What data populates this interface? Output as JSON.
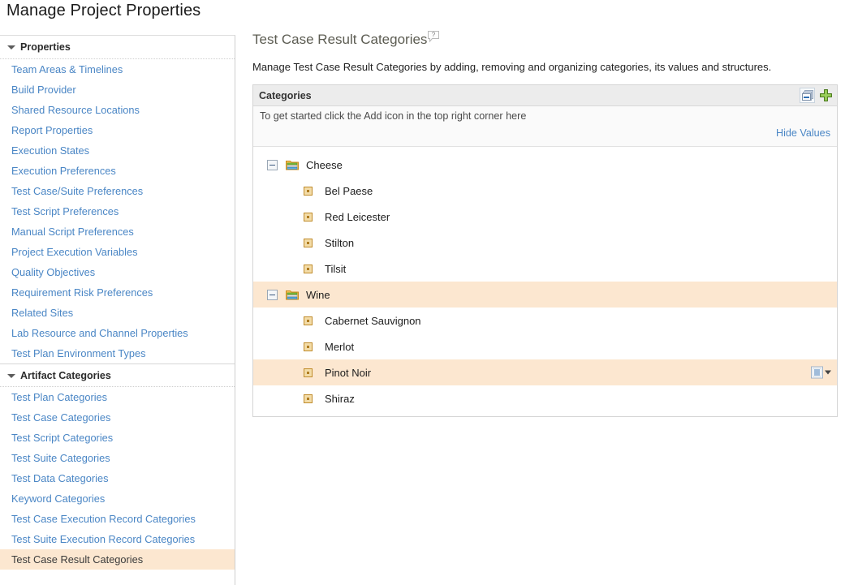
{
  "page": {
    "title": "Manage Project Properties"
  },
  "sidebar": {
    "sections": [
      {
        "title": "Properties",
        "items": [
          {
            "label": "Team Areas & Timelines",
            "selected": false
          },
          {
            "label": "Build Provider",
            "selected": false
          },
          {
            "label": "Shared Resource Locations",
            "selected": false
          },
          {
            "label": "Report Properties",
            "selected": false
          },
          {
            "label": "Execution States",
            "selected": false
          },
          {
            "label": "Execution Preferences",
            "selected": false
          },
          {
            "label": "Test Case/Suite Preferences",
            "selected": false
          },
          {
            "label": "Test Script Preferences",
            "selected": false
          },
          {
            "label": "Manual Script Preferences",
            "selected": false
          },
          {
            "label": "Project Execution Variables",
            "selected": false
          },
          {
            "label": "Quality Objectives",
            "selected": false
          },
          {
            "label": "Requirement Risk Preferences",
            "selected": false
          },
          {
            "label": "Related Sites",
            "selected": false
          },
          {
            "label": "Lab Resource and Channel Properties",
            "selected": false
          },
          {
            "label": "Test Plan Environment Types",
            "selected": false
          }
        ]
      },
      {
        "title": "Artifact Categories",
        "items": [
          {
            "label": "Test Plan Categories",
            "selected": false
          },
          {
            "label": "Test Case Categories",
            "selected": false
          },
          {
            "label": "Test Script Categories",
            "selected": false
          },
          {
            "label": "Test Suite Categories",
            "selected": false
          },
          {
            "label": "Test Data Categories",
            "selected": false
          },
          {
            "label": "Keyword Categories",
            "selected": false
          },
          {
            "label": "Test Case Execution Record Categories",
            "selected": false
          },
          {
            "label": "Test Suite Execution Record Categories",
            "selected": false
          },
          {
            "label": "Test Case Result Categories",
            "selected": true
          }
        ]
      }
    ]
  },
  "main": {
    "heading": "Test Case Result Categories",
    "help_icon": "help-question-icon",
    "description": "Manage Test Case Result Categories by adding, removing and organizing categories, its values and structures.",
    "panel": {
      "header_title": "Categories",
      "tools": [
        {
          "name": "collapse-all-icon",
          "label": "Collapse All"
        },
        {
          "name": "add-icon",
          "label": "Add"
        }
      ],
      "hint": "To get started click the Add icon in the top right corner here",
      "hide_values_label": "Hide Values",
      "tree": [
        {
          "type": "category",
          "label": "Cheese",
          "expanded": true,
          "highlight": false,
          "menu": false,
          "values": [
            {
              "label": "Bel Paese",
              "highlight": false,
              "menu": false
            },
            {
              "label": "Red Leicester",
              "highlight": false,
              "menu": false
            },
            {
              "label": "Stilton",
              "highlight": false,
              "menu": false
            },
            {
              "label": "Tilsit",
              "highlight": false,
              "menu": false
            }
          ]
        },
        {
          "type": "category",
          "label": "Wine",
          "expanded": true,
          "highlight": true,
          "menu": false,
          "values": [
            {
              "label": "Cabernet Sauvignon",
              "highlight": false,
              "menu": false
            },
            {
              "label": "Merlot",
              "highlight": false,
              "menu": false
            },
            {
              "label": "Pinot Noir",
              "highlight": true,
              "menu": true
            },
            {
              "label": "Shiraz",
              "highlight": false,
              "menu": false
            }
          ]
        }
      ]
    }
  },
  "colors": {
    "link": "#4a86c5",
    "selection_highlight": "#fce7d0",
    "panel_header_bg": "#ececec",
    "heading_text": "#5c5c52",
    "add_icon_green": "#6cab3a"
  }
}
